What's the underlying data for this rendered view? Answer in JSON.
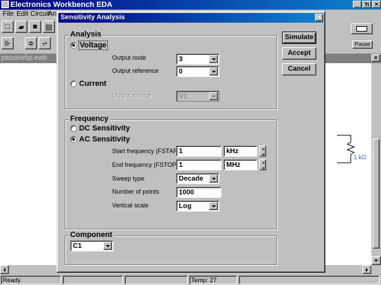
{
  "app": {
    "title": "Electronics Workbench EDA",
    "menu": [
      "File",
      "Edit",
      "Circuit",
      "An"
    ],
    "window_buttons": [
      "_",
      "ŉ",
      "×"
    ],
    "pause_label": "Pause"
  },
  "document": {
    "title": "passivebp.ewb",
    "resistor_label": "1 kΩ"
  },
  "status": {
    "ready": "Ready",
    "temp": "Temp:  27"
  },
  "dialog": {
    "title": "Sensitivity Analysis",
    "close": "×",
    "buttons": {
      "simulate": "Simulate",
      "accept": "Accept",
      "cancel": "Cancel"
    },
    "analysis": {
      "label": "Analysis",
      "voltage": "Voltage",
      "current": "Current",
      "output_node_label": "Output node",
      "output_node_value": "3",
      "output_reference_label": "Output reference",
      "output_reference_value": "0",
      "output_source_label": "Output source",
      "output_source_value": "V1"
    },
    "frequency": {
      "label": "Frequency",
      "dc": "DC Sensitivity",
      "ac": "AC Sensitivity",
      "start_label": "Start frequency (FSTART)",
      "start_value": "1",
      "start_unit": "kHz",
      "end_label": "End frequency (FSTOP)",
      "end_value": "1",
      "end_unit": "MHz",
      "sweep_label": "Sweep type",
      "sweep_value": "Decade",
      "points_label": "Number of points",
      "points_value": "1000",
      "vscale_label": "Vertical scale",
      "vscale_value": "Log"
    },
    "component": {
      "label": "Component",
      "value": "C1"
    }
  }
}
